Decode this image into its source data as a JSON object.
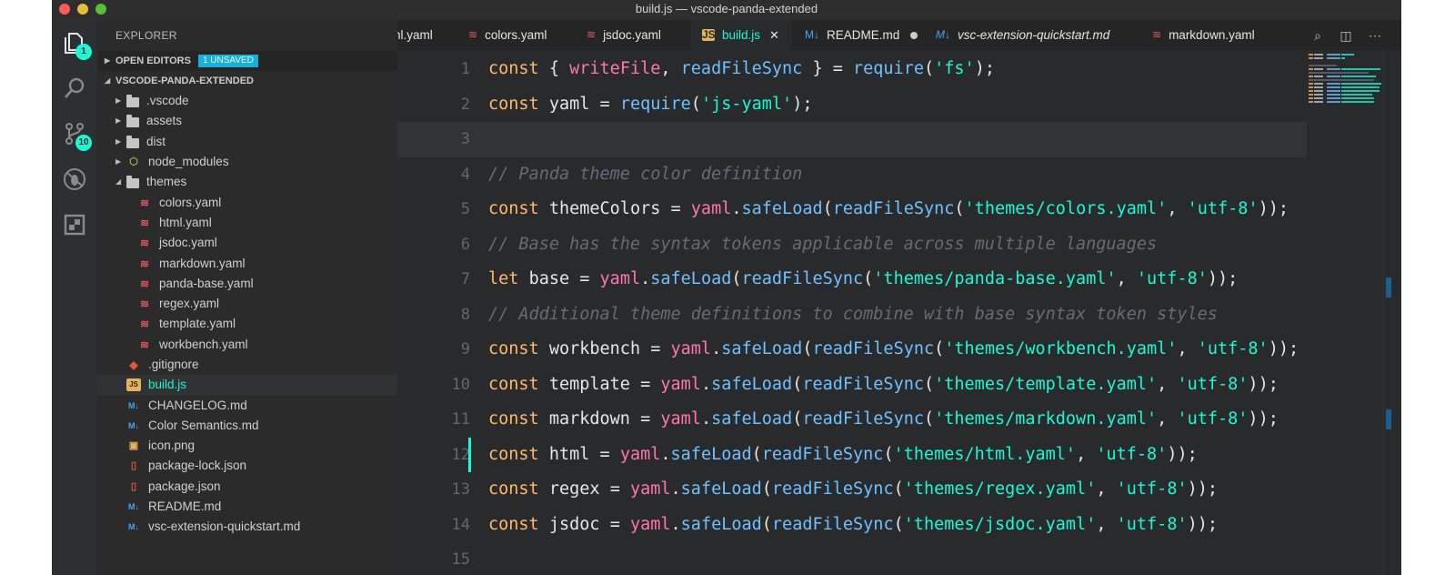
{
  "window": {
    "title": "build.js — vscode-panda-extended"
  },
  "activity_bar": {
    "explorer_badge": "1",
    "scm_badge": "10",
    "icons": [
      "files-icon",
      "search-icon",
      "source-control-icon",
      "debug-icon",
      "extensions-icon"
    ]
  },
  "sidebar": {
    "title": "EXPLORER",
    "open_editors_label": "OPEN EDITORS",
    "unsaved_badge": "1 UNSAVED",
    "project_label": "VSCODE-PANDA-EXTENDED",
    "items": [
      {
        "label": ".vscode",
        "type": "folder"
      },
      {
        "label": "assets",
        "type": "folder"
      },
      {
        "label": "dist",
        "type": "folder"
      },
      {
        "label": "node_modules",
        "type": "node-folder"
      },
      {
        "label": "themes",
        "type": "folder-open"
      },
      {
        "label": "colors.yaml",
        "type": "yaml"
      },
      {
        "label": "html.yaml",
        "type": "yaml"
      },
      {
        "label": "jsdoc.yaml",
        "type": "yaml"
      },
      {
        "label": "markdown.yaml",
        "type": "yaml"
      },
      {
        "label": "panda-base.yaml",
        "type": "yaml"
      },
      {
        "label": "regex.yaml",
        "type": "yaml"
      },
      {
        "label": "template.yaml",
        "type": "yaml"
      },
      {
        "label": "workbench.yaml",
        "type": "yaml"
      },
      {
        "label": ".gitignore",
        "type": "git"
      },
      {
        "label": "build.js",
        "type": "js"
      },
      {
        "label": "CHANGELOG.md",
        "type": "md"
      },
      {
        "label": "Color Semantics.md",
        "type": "md"
      },
      {
        "label": "icon.png",
        "type": "png"
      },
      {
        "label": "package-lock.json",
        "type": "json"
      },
      {
        "label": "package.json",
        "type": "json"
      },
      {
        "label": "README.md",
        "type": "md"
      },
      {
        "label": "vsc-extension-quickstart.md",
        "type": "md"
      }
    ]
  },
  "tabs": [
    {
      "label": "nl.yaml"
    },
    {
      "label": "colors.yaml"
    },
    {
      "label": "jsdoc.yaml"
    },
    {
      "label": "build.js"
    },
    {
      "label": "README.md"
    },
    {
      "label": "vsc-extension-quickstart.md"
    },
    {
      "label": "markdown.yaml"
    }
  ],
  "tab_close_glyph": "✕",
  "code": {
    "line_numbers": [
      "1",
      "2",
      "3",
      "4",
      "5",
      "6",
      "7",
      "8",
      "9",
      "10",
      "11",
      "12",
      "13",
      "14",
      "15"
    ],
    "current_line": "3",
    "lines": [
      "const { writeFile, readFileSync } = require('fs');",
      "const yaml = require('js-yaml');",
      "",
      "// Panda theme color definition",
      "const themeColors = yaml.safeLoad(readFileSync('themes/colors.yaml', 'utf-8'));",
      "// Base has the syntax tokens applicable across multiple languages",
      "let base = yaml.safeLoad(readFileSync('themes/panda-base.yaml', 'utf-8'));",
      "// Additional theme definitions to combine with base syntax token styles",
      "const workbench = yaml.safeLoad(readFileSync('themes/workbench.yaml', 'utf-8'));",
      "const template = yaml.safeLoad(readFileSync('themes/template.yaml', 'utf-8'));",
      "const markdown = yaml.safeLoad(readFileSync('themes/markdown.yaml', 'utf-8'));",
      "const html = yaml.safeLoad(readFileSync('themes/html.yaml', 'utf-8'));",
      "const regex = yaml.safeLoad(readFileSync('themes/regex.yaml', 'utf-8'));",
      "const jsdoc = yaml.safeLoad(readFileSync('themes/jsdoc.yaml', 'utf-8'));",
      ""
    ]
  },
  "colors": {
    "accent": "#19f9d8",
    "keyword": "#ffb86c",
    "function": "#6fc1ff",
    "string": "#19f9d8",
    "identifier": "#ff75b5",
    "comment": "#676b79",
    "background": "#292a2b"
  }
}
